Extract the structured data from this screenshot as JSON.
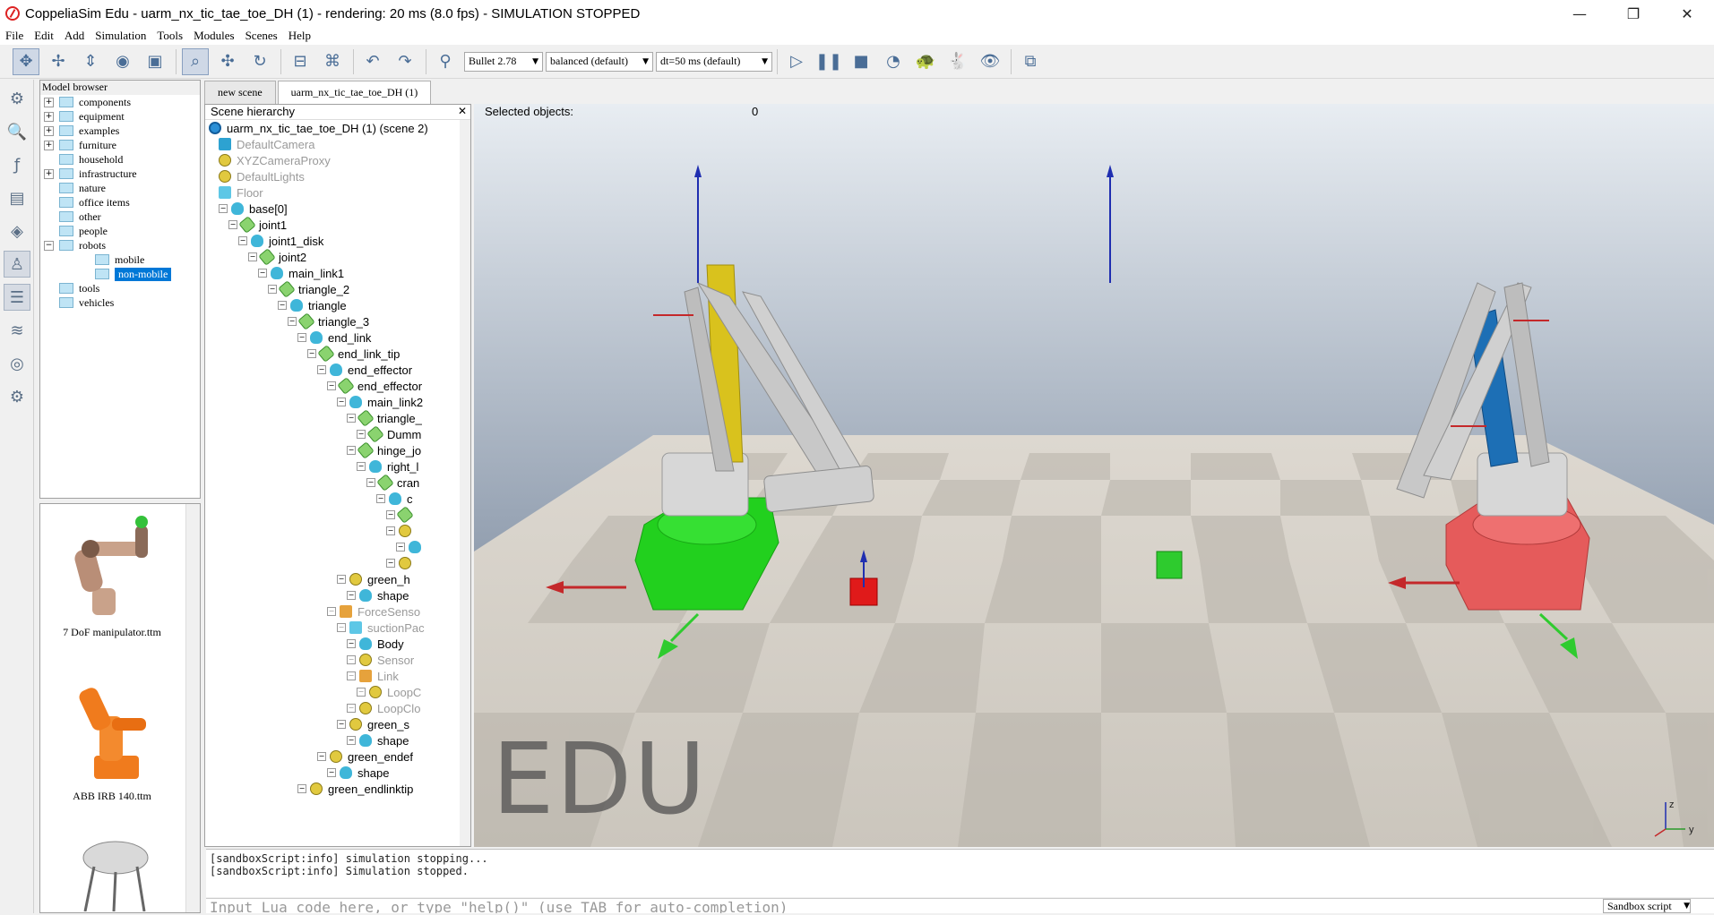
{
  "window": {
    "title": "CoppeliaSim Edu - uarm_nx_tic_tae_toe_DH (1) - rendering: 20 ms (8.0 fps) - SIMULATION STOPPED",
    "minimize": "—",
    "maximize": "❐",
    "close": "✕"
  },
  "menu": [
    "File",
    "Edit",
    "Add",
    "Simulation",
    "Tools",
    "Modules",
    "Scenes",
    "Help"
  ],
  "toolbar": {
    "engine": "Bullet 2.78",
    "accuracy": "balanced (default)",
    "dt": "dt=50 ms (default)"
  },
  "model_browser": {
    "header": "Model browser",
    "items": [
      {
        "label": "components",
        "expandable": true,
        "indent": 0
      },
      {
        "label": "equipment",
        "expandable": true,
        "indent": 0
      },
      {
        "label": "examples",
        "expandable": true,
        "indent": 0
      },
      {
        "label": "furniture",
        "expandable": true,
        "indent": 0
      },
      {
        "label": "household",
        "expandable": false,
        "indent": 0
      },
      {
        "label": "infrastructure",
        "expandable": true,
        "indent": 0
      },
      {
        "label": "nature",
        "expandable": false,
        "indent": 0
      },
      {
        "label": "office items",
        "expandable": false,
        "indent": 0
      },
      {
        "label": "other",
        "expandable": false,
        "indent": 0
      },
      {
        "label": "people",
        "expandable": false,
        "indent": 0
      },
      {
        "label": "robots",
        "expandable": "open",
        "indent": 0
      },
      {
        "label": "mobile",
        "expandable": false,
        "indent": 1
      },
      {
        "label": "non-mobile",
        "expandable": false,
        "indent": 1,
        "selected": true
      },
      {
        "label": "tools",
        "expandable": false,
        "indent": 0
      },
      {
        "label": "vehicles",
        "expandable": false,
        "indent": 0
      }
    ],
    "thumbnails": [
      "7 DoF manipulator.ttm",
      "ABB IRB 140.ttm"
    ]
  },
  "tabs": [
    {
      "label": "new scene",
      "active": false
    },
    {
      "label": "uarm_nx_tic_tae_toe_DH (1)",
      "active": true
    }
  ],
  "hierarchy": {
    "header": "Scene hierarchy",
    "close": "✕",
    "rows": [
      {
        "label": "uarm_nx_tic_tae_toe_DH (1) (scene 2)",
        "icon": "world",
        "depth": 0,
        "grey": false
      },
      {
        "label": "DefaultCamera",
        "icon": "cam",
        "depth": 1,
        "grey": true
      },
      {
        "label": "XYZCameraProxy",
        "icon": "dummy",
        "depth": 1,
        "grey": true
      },
      {
        "label": "DefaultLights",
        "icon": "dummy",
        "depth": 1,
        "grey": true
      },
      {
        "label": "Floor",
        "icon": "cube",
        "depth": 1,
        "grey": true
      },
      {
        "label": "base[0]",
        "icon": "shape",
        "depth": 1,
        "grey": false
      },
      {
        "label": "joint1",
        "icon": "joint",
        "depth": 2,
        "grey": false
      },
      {
        "label": "joint1_disk",
        "icon": "shape",
        "depth": 3,
        "grey": false
      },
      {
        "label": "joint2",
        "icon": "joint",
        "depth": 4,
        "grey": false
      },
      {
        "label": "main_link1",
        "icon": "shape",
        "depth": 5,
        "grey": false
      },
      {
        "label": "triangle_2",
        "icon": "joint",
        "depth": 6,
        "grey": false
      },
      {
        "label": "triangle",
        "icon": "shape",
        "depth": 7,
        "grey": false
      },
      {
        "label": "triangle_3",
        "icon": "joint",
        "depth": 8,
        "grey": false
      },
      {
        "label": "end_link",
        "icon": "shape",
        "depth": 9,
        "grey": false
      },
      {
        "label": "end_link_tip",
        "icon": "joint",
        "depth": 10,
        "grey": false
      },
      {
        "label": "end_effector",
        "icon": "shape",
        "depth": 11,
        "grey": false
      },
      {
        "label": "end_effector",
        "icon": "joint",
        "depth": 12,
        "grey": false
      },
      {
        "label": "main_link2",
        "icon": "shape",
        "depth": 13,
        "grey": false
      },
      {
        "label": "triangle_",
        "icon": "joint",
        "depth": 14,
        "grey": false
      },
      {
        "label": "Dumm",
        "icon": "joint",
        "depth": 15,
        "grey": false
      },
      {
        "label": "hinge_jo",
        "icon": "joint",
        "depth": 14,
        "grey": false
      },
      {
        "label": "right_l",
        "icon": "shape",
        "depth": 15,
        "grey": false
      },
      {
        "label": "cran",
        "icon": "joint",
        "depth": 16,
        "grey": false
      },
      {
        "label": "c",
        "icon": "shape",
        "depth": 17,
        "grey": false
      },
      {
        "label": "",
        "icon": "joint",
        "depth": 18,
        "grey": false
      },
      {
        "label": "",
        "icon": "dummy",
        "depth": 18,
        "grey": false
      },
      {
        "label": "",
        "icon": "shape",
        "depth": 19,
        "grey": false
      },
      {
        "label": "",
        "icon": "dummy",
        "depth": 18,
        "grey": false
      },
      {
        "label": "green_h",
        "icon": "dummy",
        "depth": 13,
        "grey": false
      },
      {
        "label": "shape",
        "icon": "shape",
        "depth": 14,
        "grey": false
      },
      {
        "label": "ForceSenso",
        "icon": "force",
        "depth": 12,
        "grey": true
      },
      {
        "label": "suctionPac",
        "icon": "cube",
        "depth": 13,
        "grey": true
      },
      {
        "label": "Body",
        "icon": "shape",
        "depth": 14,
        "grey": false
      },
      {
        "label": "Sensor",
        "icon": "dummy",
        "depth": 14,
        "grey": true
      },
      {
        "label": "Link",
        "icon": "force",
        "depth": 14,
        "grey": true
      },
      {
        "label": "LoopC",
        "icon": "dummy",
        "depth": 15,
        "grey": true
      },
      {
        "label": "LoopClo",
        "icon": "dummy",
        "depth": 14,
        "grey": true
      },
      {
        "label": "green_s",
        "icon": "dummy",
        "depth": 13,
        "grey": false
      },
      {
        "label": "shape",
        "icon": "shape",
        "depth": 14,
        "grey": false
      },
      {
        "label": "green_endef",
        "icon": "dummy",
        "depth": 11,
        "grey": false
      },
      {
        "label": "shape",
        "icon": "shape",
        "depth": 12,
        "grey": false
      },
      {
        "label": "green_endlinktip",
        "icon": "dummy",
        "depth": 9,
        "grey": false
      }
    ]
  },
  "viewport": {
    "selected_label": "Selected objects:",
    "selected_count": "0",
    "watermark": "EDU",
    "axis_z": "z",
    "axis_y": "y"
  },
  "console": {
    "lines": [
      "[sandboxScript:info] simulation stopping...",
      "[sandboxScript:info] Simulation stopped."
    ],
    "input_placeholder": "Input Lua code here, or type \"help()\" (use TAB for auto-completion)",
    "script_selector": "Sandbox script"
  },
  "colors": {
    "selection": "#0078d7",
    "robot_left_base": "#22d01e",
    "robot_right_base": "#e55b5b",
    "left_link": "#d9c21d",
    "right_link": "#1d6fb5"
  }
}
